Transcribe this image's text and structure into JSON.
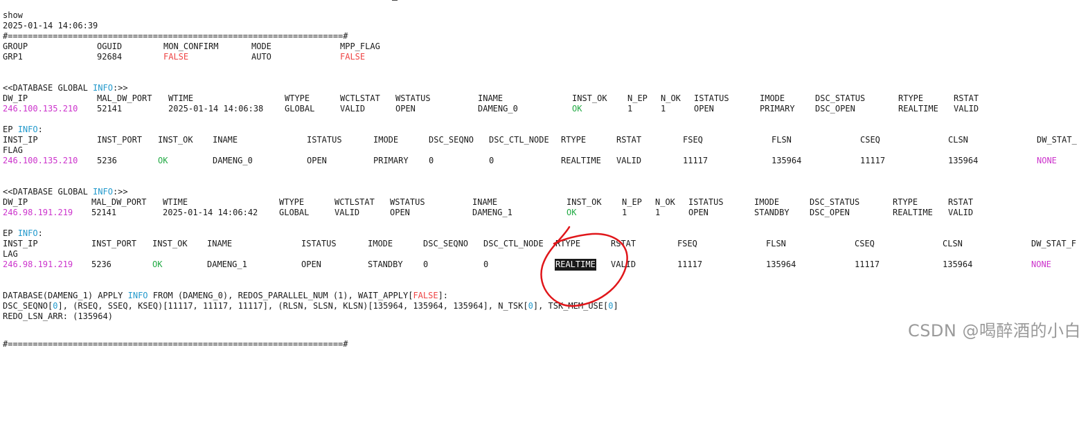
{
  "title": "show",
  "timestamp": "2025-01-14 14:06:39",
  "separator": "#===================================================================#",
  "group": {
    "headers": [
      "GROUP",
      "OGUID",
      "MON_CONFIRM",
      "MODE",
      "MPP_FLAG"
    ],
    "values": [
      "GRP1",
      "92684",
      "FALSE",
      "AUTO",
      "FALSE"
    ]
  },
  "db_prefix": "<<DATABASE GLOBAL ",
  "info_word": "INFO",
  "db_suffix": ":>>",
  "ep_prefix": "EP ",
  "ep_suffix": ":",
  "db_headers": [
    "DW_IP",
    "MAL_DW_PORT",
    "WTIME",
    "WTYPE",
    "WCTLSTAT",
    "WSTATUS",
    "INAME",
    "INST_OK",
    "N_EP",
    "N_OK",
    "ISTATUS",
    "IMODE",
    "DSC_STATUS",
    "RTYPE",
    "RSTAT"
  ],
  "db1": [
    "246.100.135.210",
    "52141",
    "2025-01-14 14:06:38",
    "GLOBAL",
    "VALID",
    "OPEN",
    "DAMENG_0",
    "OK",
    "1",
    "1",
    "OPEN",
    "PRIMARY",
    "DSC_OPEN",
    "REALTIME",
    "VALID"
  ],
  "db2": [
    "246.98.191.219",
    "52141",
    "2025-01-14 14:06:42",
    "GLOBAL",
    "VALID",
    "OPEN",
    "DAMENG_1",
    "OK",
    "1",
    "1",
    "OPEN",
    "STANDBY",
    "DSC_OPEN",
    "REALTIME",
    "VALID"
  ],
  "ep_headers": [
    "INST_IP",
    "INST_PORT",
    "INST_OK",
    "INAME",
    "ISTATUS",
    "IMODE",
    "DSC_SEQNO",
    "DSC_CTL_NODE",
    "RTYPE",
    "RSTAT",
    "FSEQ",
    "FLSN",
    "CSEQ",
    "CLSN"
  ],
  "ep1_last_header": "DW_STAT_",
  "ep1_wrap": "FLAG",
  "ep2_last_header": "DW_STAT_F",
  "ep2_wrap": "LAG",
  "ep1": [
    "246.100.135.210",
    "5236",
    "OK",
    "DAMENG_0",
    "OPEN",
    "PRIMARY",
    "0",
    "0",
    "REALTIME",
    "VALID",
    "11117",
    "135964",
    "11117",
    "135964",
    "NONE"
  ],
  "ep2": [
    "246.98.191.219",
    "5236",
    "OK",
    "DAMENG_1",
    "OPEN",
    "STANDBY",
    "0",
    "0",
    "REALTIME",
    "VALID",
    "11117",
    "135964",
    "11117",
    "135964",
    "NONE"
  ],
  "apply": {
    "l1_a": "DATABASE(DAMENG_1) APPLY ",
    "l1_info": "INFO",
    "l1_b": " FROM (DAMENG_0), REDOS_PARALLEL_NUM (1), WAIT_APPLY[",
    "l1_false": "FALSE",
    "l1_c": "]:",
    "l2_a": "DSC_SEQNO[",
    "l2_z1": "0",
    "l2_b": "], (RSEQ, SSEQ, KSEQ)[11117, 11117, 11117], (RLSN, SLSN, KLSN)[135964, 135964, 135964], N_TSK[",
    "l2_z2": "0",
    "l2_c": "], TSK_MEM_USE[",
    "l2_z3": "0",
    "l2_d": "]",
    "l3": "REDO_LSN_ARR: (135964)"
  },
  "watermark": "CSDN @喝醉酒的小白",
  "colors": {
    "magenta": "#cc33cc",
    "red": "#ee4444",
    "green": "#22aa44",
    "cyan": "#2299cc",
    "annotation": "#e0161a"
  }
}
